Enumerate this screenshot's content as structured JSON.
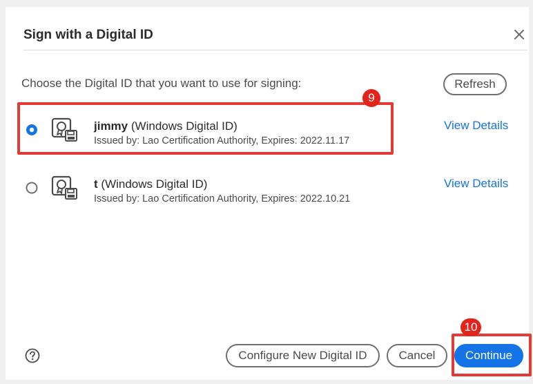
{
  "dialog": {
    "title": "Sign with a Digital ID",
    "close_icon": "close-icon",
    "instruction": "Choose the Digital ID that you want to use for signing:",
    "refresh_label": "Refresh"
  },
  "ids": [
    {
      "name": "jimmy",
      "type": "(Windows Digital ID)",
      "issuer": "Issued by: Lao Certification Authority, Expires: 2022.11.17",
      "view_details": "View Details",
      "selected": true
    },
    {
      "name": "t",
      "type": "(Windows Digital ID)",
      "issuer": "Issued by: Lao Certification Authority, Expires: 2022.10.21",
      "view_details": "View Details",
      "selected": false
    }
  ],
  "footer": {
    "help_icon": "help-icon",
    "configure_label": "Configure New Digital ID",
    "cancel_label": "Cancel",
    "continue_label": "Continue"
  },
  "annotations": {
    "step_select_id": "9",
    "step_continue": "10"
  },
  "colors": {
    "accent": "#1473e6",
    "annotation_red": "#e53935"
  }
}
